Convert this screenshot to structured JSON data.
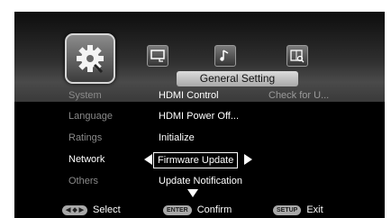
{
  "menu_title": "General Setting",
  "categories": [
    {
      "label": "System",
      "active": false
    },
    {
      "label": "Language",
      "active": false
    },
    {
      "label": "Ratings",
      "active": false
    },
    {
      "label": "Network",
      "active": true
    },
    {
      "label": "Others",
      "active": false
    }
  ],
  "options": [
    {
      "label": "HDMI Control",
      "selected": false
    },
    {
      "label": "HDMI Power Off...",
      "selected": false
    },
    {
      "label": "Initialize",
      "selected": false
    },
    {
      "label": "Firmware Update",
      "selected": true
    },
    {
      "label": "Update Notification",
      "selected": false
    }
  ],
  "sub_value": "Check for U...",
  "icons": {
    "main": "gear-wrench-icon",
    "tab1": "display-icon",
    "tab2": "music-note-icon",
    "tab3": "book-search-icon"
  },
  "hints": {
    "nav_key": "◀ ◆ ▶",
    "select_label": "Select",
    "enter_key": "ENTER",
    "confirm_label": "Confirm",
    "setup_key": "SETUP",
    "exit_label": "Exit"
  }
}
